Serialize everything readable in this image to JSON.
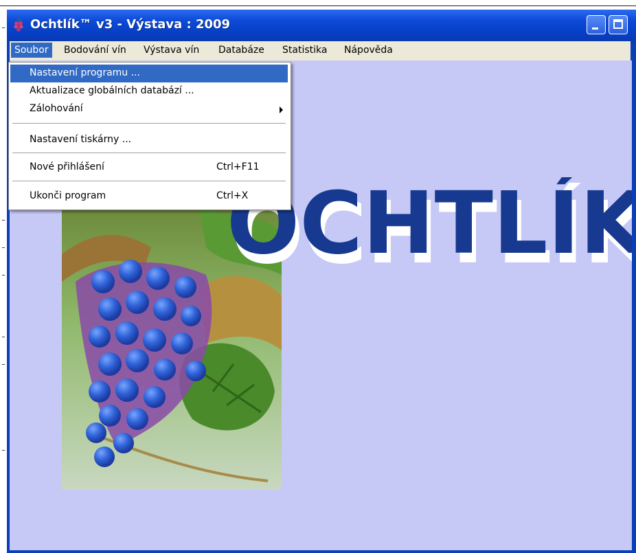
{
  "window": {
    "title": "Ochtlík™ v3 - Výstava : 2009"
  },
  "menubar": {
    "items": [
      {
        "label": "Soubor"
      },
      {
        "label": "Bodování vín"
      },
      {
        "label": "Výstava vín"
      },
      {
        "label": "Databáze"
      },
      {
        "label": "Statistika"
      },
      {
        "label": "Nápověda"
      }
    ]
  },
  "menu": {
    "items": [
      {
        "label": "Nastavení programu ..."
      },
      {
        "label": "Aktualizace globálních databází ..."
      },
      {
        "label": "Zálohování"
      },
      {
        "label": "Nastavení tiskárny ..."
      },
      {
        "label": "Nové přihlášení",
        "shortcut": "Ctrl+F11"
      },
      {
        "label": "Ukonči program",
        "shortcut": "Ctrl+X"
      }
    ]
  },
  "logo": {
    "text": "OCHTLÍK"
  },
  "colors": {
    "titlebar": "#0d4ad6",
    "menu_highlight": "#316ac5",
    "client_bg": "#c6c8f6",
    "logo_blue": "#17398f"
  },
  "icons": {
    "app": "grape-icon",
    "minimize": "minimize-icon",
    "maximize": "maximize-icon",
    "submenu": "submenu-arrow-icon"
  }
}
